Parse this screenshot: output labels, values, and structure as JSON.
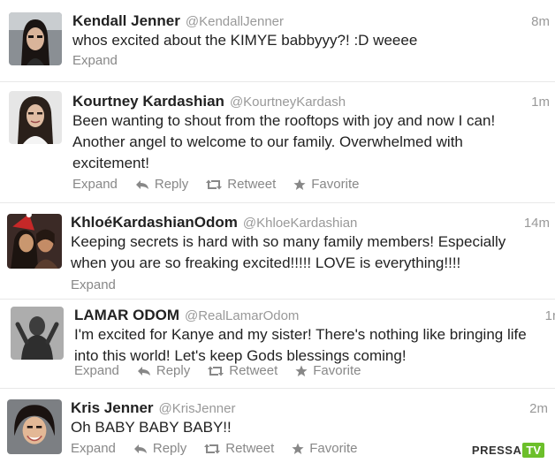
{
  "tweets": [
    {
      "name": "Kendall Jenner",
      "handle": "@KendallJenner",
      "time": "8m",
      "text": "whos excited about the KIMYE babbyyy?! :D weeee",
      "expand": "Expand",
      "reply": "",
      "retweet": "",
      "favorite": ""
    },
    {
      "name": "Kourtney Kardashian",
      "handle": "@KourtneyKardash",
      "time": "1m",
      "text": "Been wanting to shout from the rooftops with joy and now I can! Another angel to welcome to our family. Overwhelmed with excitement!",
      "expand": "Expand",
      "reply": "Reply",
      "retweet": "Retweet",
      "favorite": "Favorite"
    },
    {
      "name": "KhloéKardashianOdom",
      "handle": "@KhloeKardashian",
      "time": "14m",
      "text": "Keeping secrets is hard with so many family members! Especially when you are so freaking excited!!!!! LOVE is everything!!!!",
      "expand": "Expand",
      "reply": "",
      "retweet": "",
      "favorite": ""
    },
    {
      "name": "LAMAR ODOM",
      "handle": "@RealLamarOdom",
      "time": "1r",
      "text": "I'm excited for Kanye and my sister! There's nothing like bringing life into this world! Let's keep Gods blessings coming!",
      "expand": "Expand",
      "reply": "Reply",
      "retweet": "Retweet",
      "favorite": "Favorite"
    },
    {
      "name": "Kris Jenner",
      "handle": "@KrisJenner",
      "time": "2m",
      "text": "Oh BABY BABY BABY!!",
      "expand": "Expand",
      "reply": "Reply",
      "retweet": "Retweet",
      "favorite": "Favorite"
    }
  ],
  "watermark": {
    "part1": "PRESSA",
    "part2": "TV"
  },
  "colors": {
    "text": "#222222",
    "muted": "#999999",
    "action": "#888888",
    "watermark_green": "#6cbf2a"
  }
}
